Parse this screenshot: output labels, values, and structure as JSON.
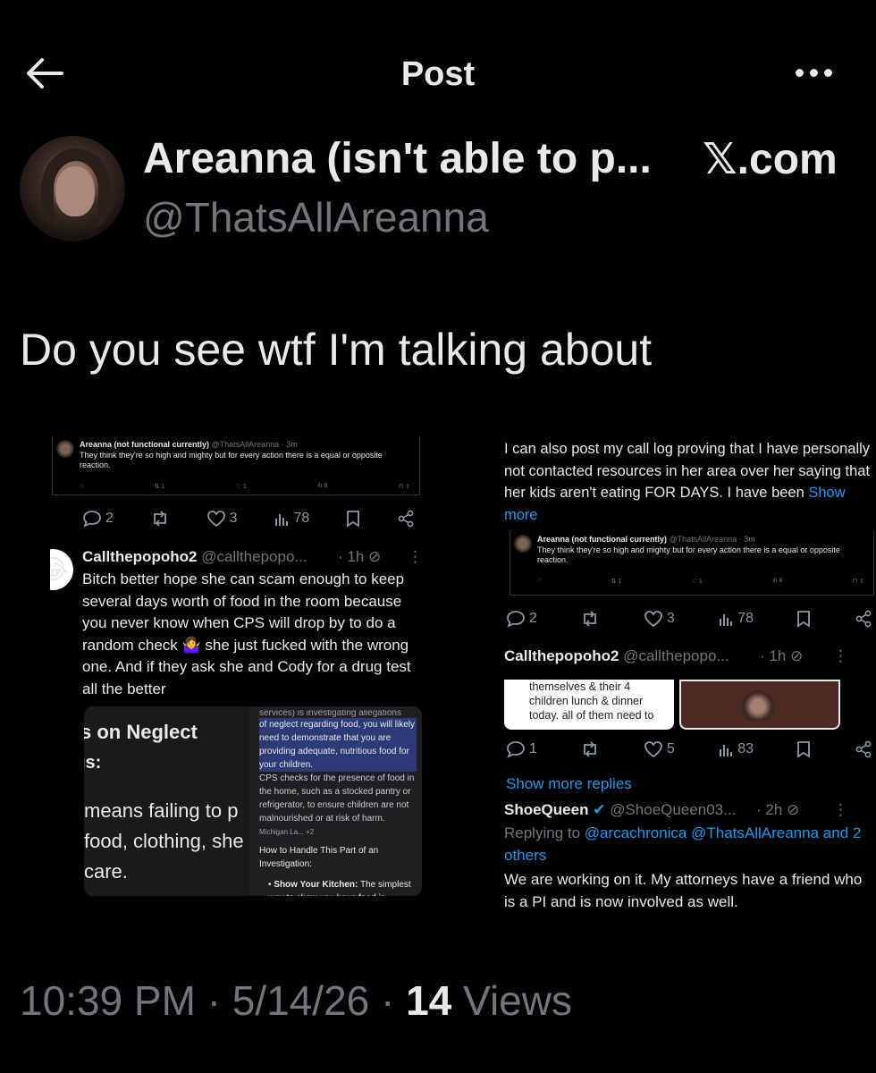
{
  "nav": {
    "title": "Post"
  },
  "author": {
    "name": "Areanna (isn't able to p...",
    "handle": "@ThatsAllAreanna",
    "source": "𝕏.com"
  },
  "post": {
    "text": "Do you see wtf I'm talking about"
  },
  "left_screenshot": {
    "quoted": {
      "name": "Areanna (not functional currently)",
      "handle": "@ThatsAllAreanna · 3m",
      "text": "They think they're so high and mighty but for every action there is a equal or opposite reaction.",
      "reposts": "1",
      "likes": "1",
      "views": "8"
    },
    "actions": {
      "replies": "2",
      "likes": "3",
      "views": "78"
    },
    "reply": {
      "name": "Callthepopoho2",
      "handle": "@callthepopo...",
      "time": "· 1h",
      "avatar_emoji": "😂",
      "text": "Bitch better hope she can scam enough to keep several days worth of food in the room because you never know when CPS will drop by to do a random check 🤷‍♀️ she just fucked with the wrong one. And if they ask she and Cody for a drug test all the better"
    },
    "card_left": {
      "heading": "s on Neglect",
      "sub": "ıs:",
      "line1": "means failing to p",
      "line2": "food, clothing, she",
      "line3": "care."
    },
    "card_right": {
      "top": "services) is investigating allegations",
      "highlight": "of neglect regarding food, you will likely need to demonstrate that you are providing adequate, nutritious food for your children.",
      "body": "CPS checks for the presence of food in the home, such as a stocked pantry or refrigerator, to ensure children are not malnourished or at risk of harm.",
      "source": "Michigan La... +2",
      "heading": "How to Handle This Part of an Investigation:",
      "bullet_bold": "Show Your Kitchen:",
      "bullet": "The simplest way to show you have food is"
    }
  },
  "right_screenshot": {
    "top_text": "I can also post my call log proving that I have personally not contacted resources in her area over her saying that her kids aren't eating FOR DAYS. I have been",
    "show_more": "Show more",
    "quoted": {
      "name": "Areanna (not functional currently)",
      "handle": "@ThatsAllAreanna · 3m",
      "text": "They think they're so high and mighty but for every action there is a equal or opposite reaction.",
      "reposts": "1",
      "likes": "1",
      "views": "8"
    },
    "actions1": {
      "replies": "2",
      "likes": "3",
      "views": "78"
    },
    "reply1": {
      "name": "Callthepopoho2",
      "handle": "@callthepopo...",
      "time": "· 1h",
      "card_text": "themselves & their 4 children lunch & dinner today. all of them need to"
    },
    "actions2": {
      "replies": "1",
      "likes": "5",
      "views": "83"
    },
    "show_more_replies": "Show more replies",
    "reply2": {
      "name": "ShoeQueen",
      "handle": "@ShoeQueen03...",
      "time": "· 2h",
      "replying_prefix": "Replying to",
      "replying_to": "@arcachronica @ThatsAllAreanna",
      "and_others": "and 2 others",
      "text": "We are working on it. My attorneys have a friend who is a PI and is now involved as well."
    }
  },
  "footer": {
    "time": "10:39 PM · 5/14/26 ·",
    "views_count": "14",
    "views_label": "Views"
  },
  "colors": {
    "background": "#000000",
    "text": "#e7e9ea",
    "muted": "#71767b",
    "link": "#1d9bf0",
    "verified": "#1d9bf0"
  }
}
